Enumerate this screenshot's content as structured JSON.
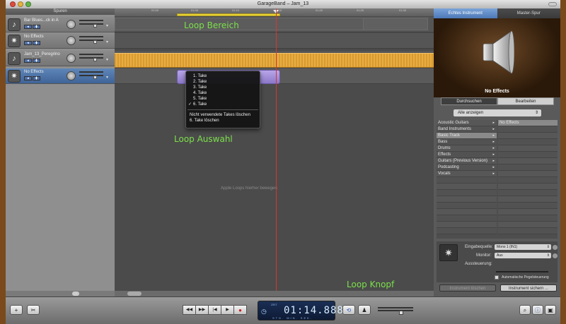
{
  "window": {
    "title": "GarageBand – Jam_13"
  },
  "tracks_header": "Spuren",
  "tracks": [
    {
      "name": "Bar Blues...ck in A",
      "icon": "guitar-icon"
    },
    {
      "name": "No Effects",
      "icon": "star-instrument-icon"
    },
    {
      "name": "Jam_13_Peregrino",
      "icon": "guitar-icon"
    },
    {
      "name": "No Effects",
      "icon": "star-instrument-icon",
      "selected": true
    }
  ],
  "ruler_ticks": [
    "01:00",
    "01:05",
    "01:10",
    "01:15",
    "01:20",
    "01:25",
    "01:30"
  ],
  "annotations": {
    "loop_bereich": "Loop Bereich",
    "loop_auswahl": "Loop Auswahl",
    "loop_knopf": "Loop Knopf"
  },
  "arrange_hint": "Apple Loops hierher bewegen",
  "take_menu": {
    "takes": [
      "1. Take",
      "2. Take",
      "3. Take",
      "4. Take",
      "5. Take",
      "6. Take"
    ],
    "checked_index": 5,
    "actions": [
      "Nicht verwendete Takes löschen",
      "6. Take löschen"
    ]
  },
  "right_panel": {
    "tabs": [
      "Echtes Instrument",
      "Master-Spur"
    ],
    "preview_label": "No Effects",
    "subtabs": [
      "Durchsuchen",
      "Bearbeiten"
    ],
    "show_all": "Alle anzeigen",
    "categories": [
      "Acoustic Guitars",
      "Band Instruments",
      "Basic Track",
      "Bass",
      "Drums",
      "Effects",
      "Guitars (Previous Version)",
      "Podcasting",
      "Vocals"
    ],
    "selected_category": 2,
    "presets": [
      "No Effects"
    ],
    "input_source_label": "Eingabequelle:",
    "input_source_value": "Mono 1 (IN1)",
    "monitor_label": "Monitor:",
    "monitor_value": "Aus",
    "level_label": "Aussteuerung:",
    "auto_level_label": "Automatische Pegelsteuerung",
    "delete_instrument": "Instrument löschen",
    "save_instrument": "Instrument sichern ..."
  },
  "transport": {
    "mode_label": "ZEIT",
    "time": "01:14.888",
    "units": "STD. MIN. SEK."
  },
  "colors": {
    "cycle_region": "#e8d436",
    "audio_region": "#d99a2e",
    "take_region": "#9c88d8",
    "playhead": "#d83434",
    "annotation": "#7be04a",
    "selected_track": "#4f74a8"
  }
}
